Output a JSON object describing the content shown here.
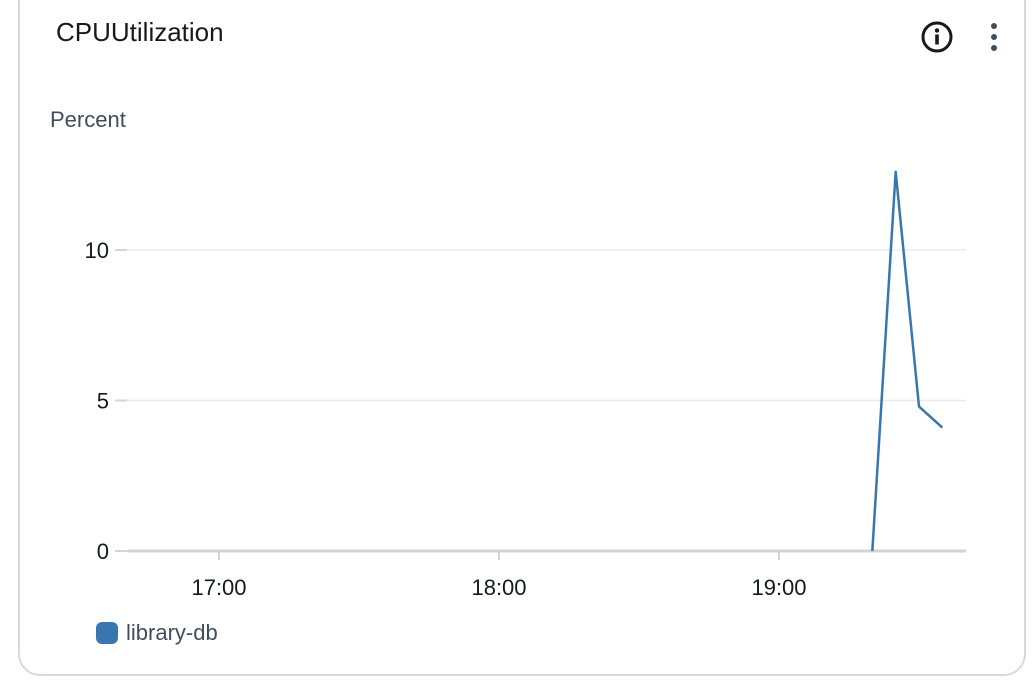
{
  "widget": {
    "title": "CPUUtilization"
  },
  "icons": {
    "info": "info-circle-icon",
    "more": "vertical-ellipsis-icon"
  },
  "colors": {
    "series": "#3a76ae",
    "grid": "#e9ebed",
    "baseline": "#d1d5db",
    "text": "#16191f"
  },
  "chart_data": {
    "type": "line",
    "title": "CPUUtilization",
    "ylabel": "Percent",
    "xlabel": "",
    "ylim": [
      0,
      13
    ],
    "yticks": [
      0,
      5,
      10
    ],
    "xlim": [
      "16:40",
      "19:40"
    ],
    "xticks": [
      "17:00",
      "18:00",
      "19:00"
    ],
    "grid": true,
    "legend_position": "bottom-left",
    "series": [
      {
        "name": "library-db",
        "color": "#3a76ae",
        "x": [
          "19:20",
          "19:25",
          "19:30",
          "19:35"
        ],
        "y": [
          0,
          12.6,
          4.8,
          4.1
        ]
      }
    ]
  }
}
